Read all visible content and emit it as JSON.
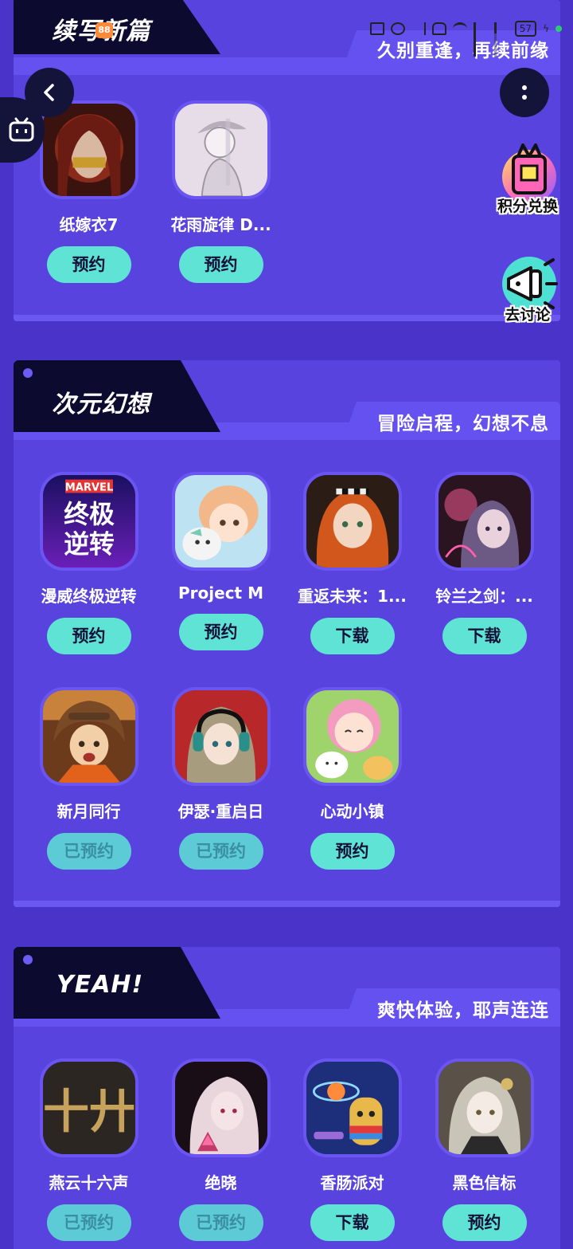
{
  "status_bar": {
    "battery": "57"
  },
  "sections": [
    {
      "title": "续写新篇",
      "subtitle": "久别重逢，再续前缘",
      "games": [
        {
          "name": "纸嫁衣7",
          "button": "预约",
          "state": "available"
        },
        {
          "name": "花雨旋律 D...",
          "button": "预约",
          "state": "available"
        }
      ]
    },
    {
      "title": "次元幻想",
      "subtitle": "冒险启程，幻想不息",
      "games": [
        {
          "name": "漫威终极逆转",
          "button": "预约",
          "state": "available"
        },
        {
          "name": "Project M",
          "button": "预约",
          "state": "available"
        },
        {
          "name": "重返未来：1...",
          "button": "下载",
          "state": "available"
        },
        {
          "name": "铃兰之剑：...",
          "button": "下载",
          "state": "available"
        },
        {
          "name": "新月同行",
          "button": "已预约",
          "state": "done"
        },
        {
          "name": "伊瑟·重启日",
          "button": "已预约",
          "state": "done"
        },
        {
          "name": "心动小镇",
          "button": "预约",
          "state": "available"
        }
      ]
    },
    {
      "title": "YEAH!",
      "subtitle": "爽快体验，耶声连连",
      "games": [
        {
          "name": "燕云十六声",
          "button": "已预约",
          "state": "done"
        },
        {
          "name": "绝晓",
          "button": "已预约",
          "state": "done"
        },
        {
          "name": "香肠派对",
          "button": "下载",
          "state": "available"
        },
        {
          "name": "黑色信标",
          "button": "预约",
          "state": "available"
        }
      ]
    }
  ],
  "icon_art": {
    "marvel_brand": "MARVEL",
    "marvel_logo_line1": "终极",
    "marvel_logo_line2": "逆转",
    "yanyun_glyph": "十廾",
    "first_section_logo_badge": "88"
  },
  "floating": {
    "points_label": "积分兑换",
    "discuss_label": "去讨论"
  },
  "colors": {
    "background": "#4a33c9",
    "panel": "#5843de",
    "tab": "#0c0a2e",
    "button": "#5fe3d5"
  }
}
